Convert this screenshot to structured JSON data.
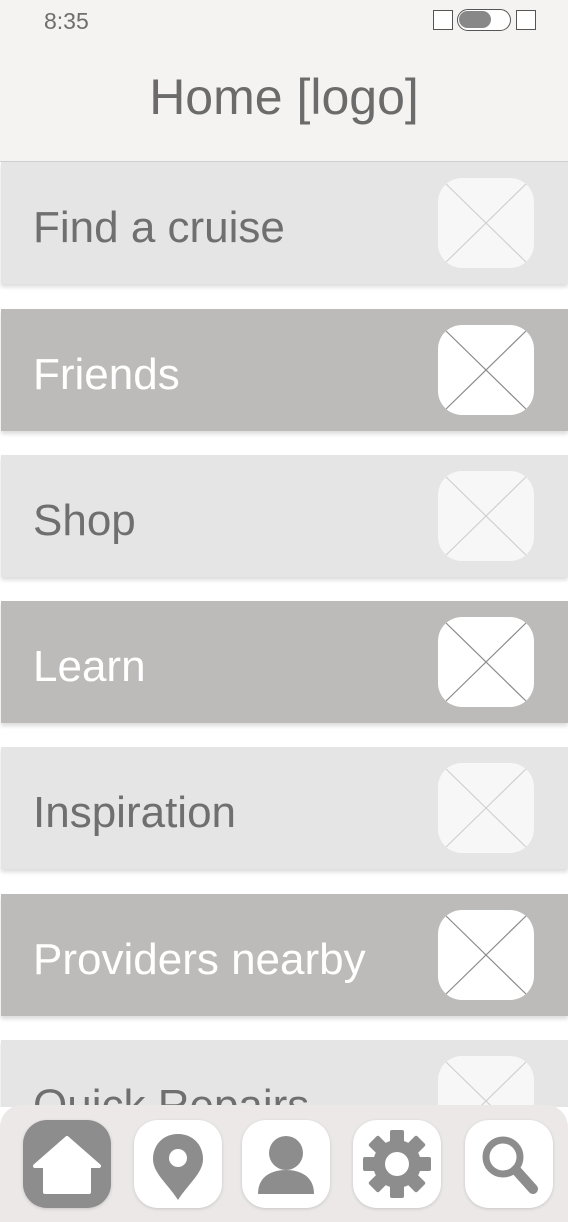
{
  "status_bar": {
    "time": "8:35"
  },
  "header": {
    "title": "Home [logo]"
  },
  "menu": {
    "items": [
      {
        "label": "Find a cruise",
        "style": "light"
      },
      {
        "label": "Friends",
        "style": "dark"
      },
      {
        "label": "Shop",
        "style": "light"
      },
      {
        "label": "Learn",
        "style": "dark"
      },
      {
        "label": "Inspiration",
        "style": "light"
      },
      {
        "label": "Providers nearby",
        "style": "dark"
      },
      {
        "label": "Quick Repairs",
        "style": "light"
      }
    ]
  },
  "tab_bar": {
    "tabs": [
      {
        "icon": "home-icon",
        "active": true
      },
      {
        "icon": "location-pin-icon",
        "active": false
      },
      {
        "icon": "user-icon",
        "active": false
      },
      {
        "icon": "gear-icon",
        "active": false
      },
      {
        "icon": "search-icon",
        "active": false
      }
    ]
  },
  "colors": {
    "header_bg": "#f4f3f2",
    "item_light": "#e5e5e5",
    "item_dark": "#bcbbba",
    "text_gray": "#6f6f6f",
    "icon_gray": "#8d8d8d"
  }
}
